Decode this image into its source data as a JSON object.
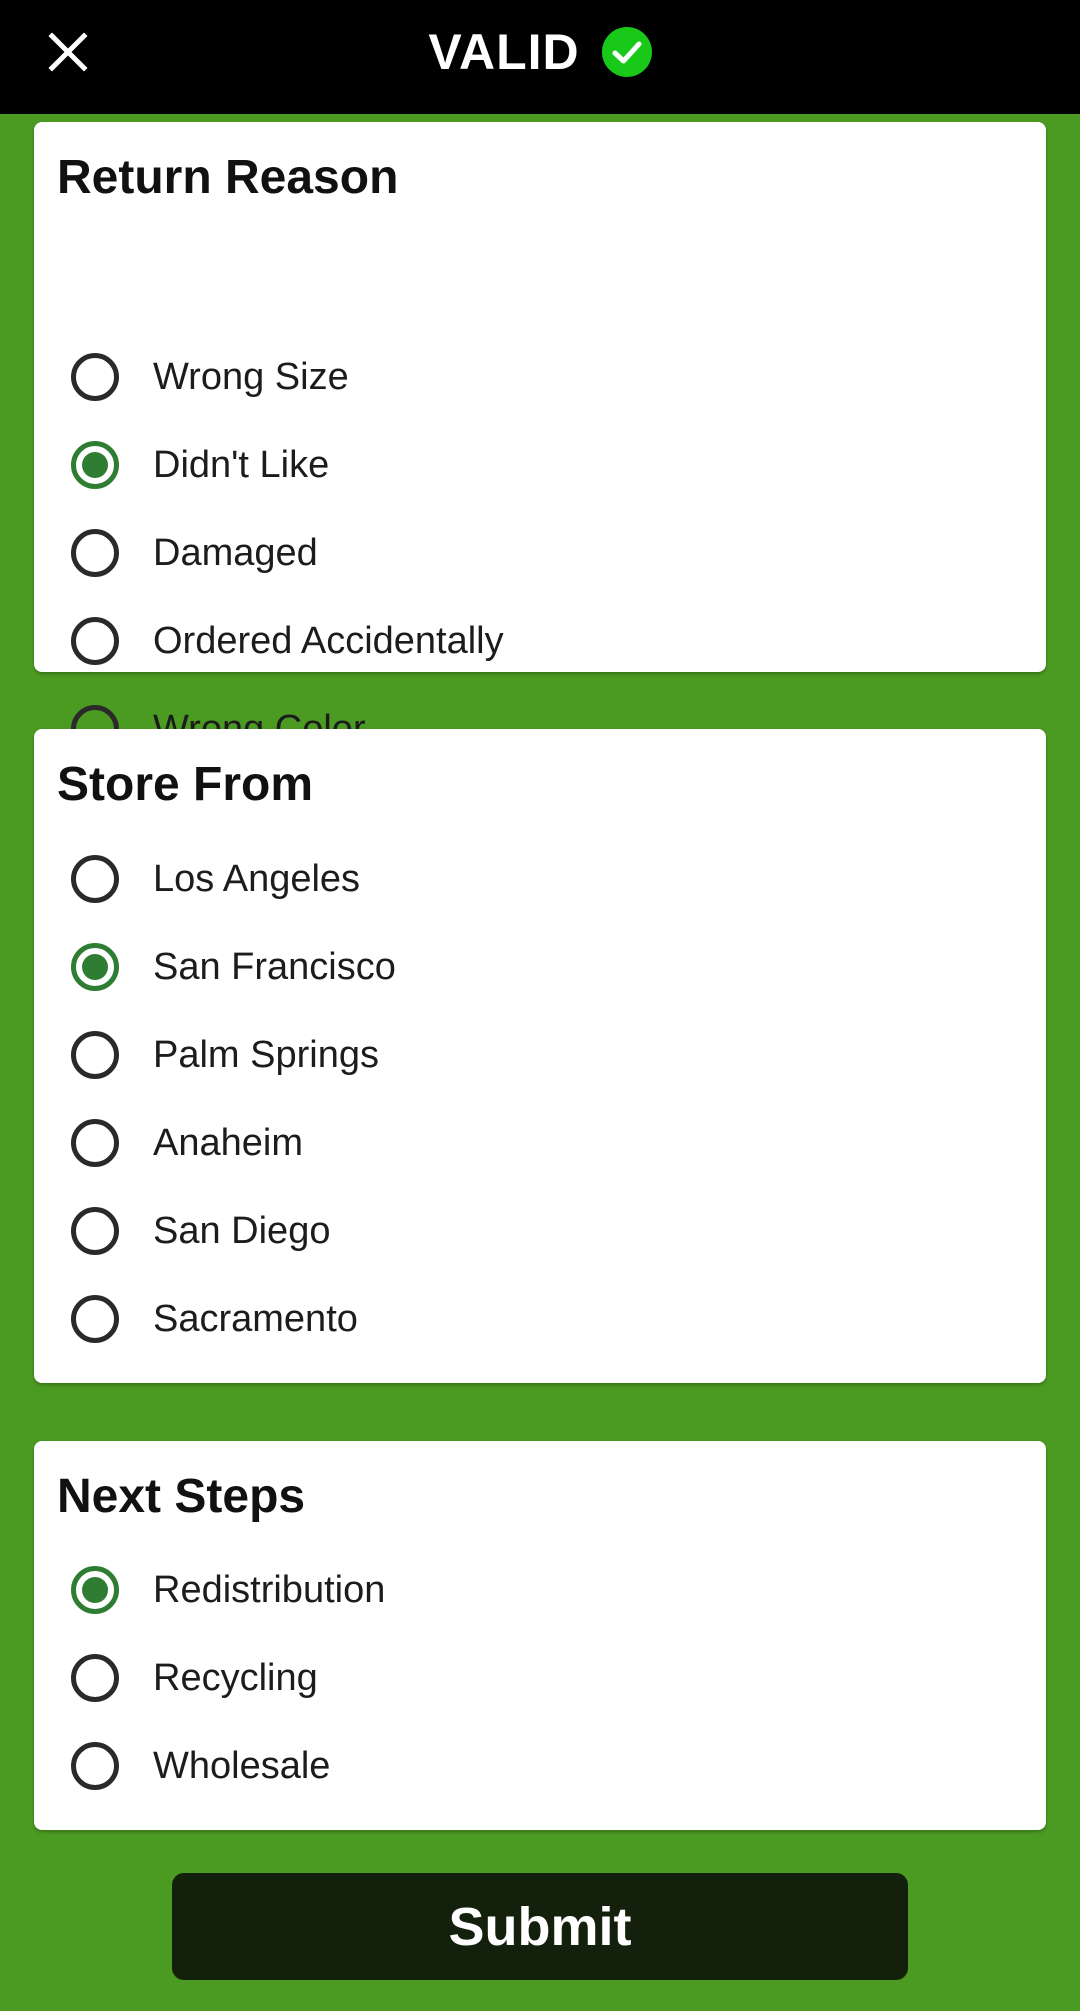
{
  "header": {
    "close_icon": "close-icon",
    "title": "VALID",
    "status_icon": "check-circle-icon",
    "status_color": "#19c919"
  },
  "colors": {
    "background": "#4b9a22",
    "topbar": "#000000",
    "radio_checked": "#2e7d32",
    "submit_bg": "#13200b"
  },
  "return_reason": {
    "title": "Return Reason",
    "options": [
      {
        "label": "Wrong Size",
        "checked": false
      },
      {
        "label": "Didn't Like",
        "checked": true
      },
      {
        "label": "Damaged",
        "checked": false
      },
      {
        "label": "Ordered Accidentally",
        "checked": false
      },
      {
        "label": "Wrong Color",
        "checked": false
      }
    ]
  },
  "store_from": {
    "title": "Store From",
    "options": [
      {
        "label": "Los Angeles",
        "checked": false
      },
      {
        "label": "San Francisco",
        "checked": true
      },
      {
        "label": "Palm Springs",
        "checked": false
      },
      {
        "label": "Anaheim",
        "checked": false
      },
      {
        "label": "San Diego",
        "checked": false
      },
      {
        "label": "Sacramento",
        "checked": false
      }
    ]
  },
  "next_steps": {
    "title": "Next Steps",
    "options": [
      {
        "label": "Redistribution",
        "checked": true
      },
      {
        "label": "Recycling",
        "checked": false
      },
      {
        "label": "Wholesale",
        "checked": false
      }
    ]
  },
  "submit": {
    "label": "Submit"
  }
}
